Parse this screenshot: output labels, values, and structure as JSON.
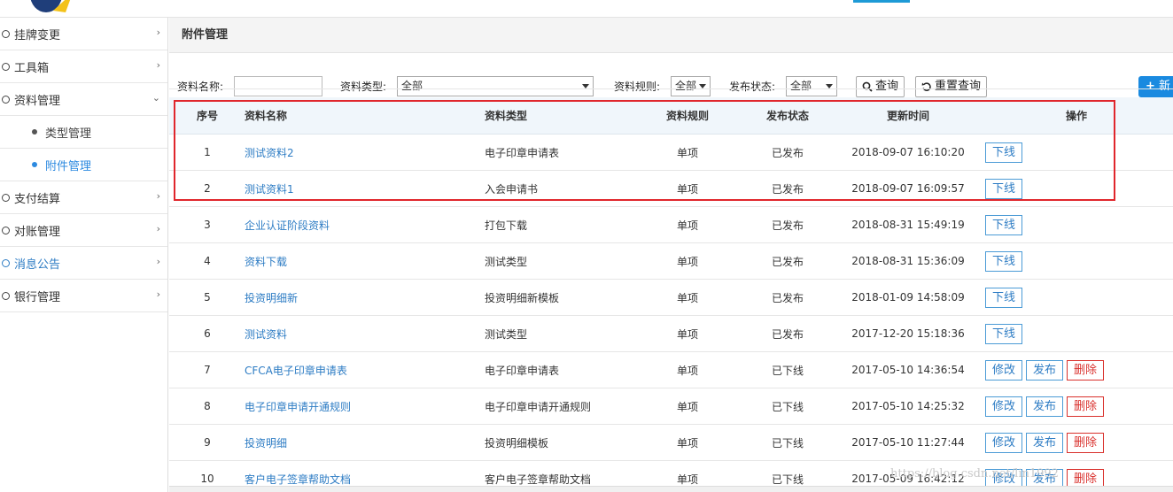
{
  "sidebar": {
    "items": [
      {
        "label": "挂牌变更"
      },
      {
        "label": "工具箱"
      },
      {
        "label": "资料管理"
      },
      {
        "label": "支付结算"
      },
      {
        "label": "对账管理"
      },
      {
        "label": "消息公告"
      },
      {
        "label": "银行管理"
      }
    ],
    "sub_items": [
      {
        "label": "类型管理"
      },
      {
        "label": "附件管理"
      }
    ]
  },
  "page": {
    "title": "附件管理"
  },
  "filters": {
    "name_label": "资料名称:",
    "name_value": "",
    "type_label": "资料类型:",
    "type_value": "全部",
    "rule_label": "资料规则:",
    "rule_value": "全部",
    "status_label": "发布状态:",
    "status_value": "全部",
    "query_label": "查询",
    "reset_label": "重置查询",
    "new_label": "新"
  },
  "table": {
    "headers": {
      "index": "序号",
      "name": "资料名称",
      "type": "资料类型",
      "rule": "资料规则",
      "status": "发布状态",
      "updated": "更新时间",
      "ops": "操作"
    },
    "rows": [
      {
        "index": "1",
        "name": "测试资料2",
        "type": "电子印章申请表",
        "rule": "单项",
        "status": "已发布",
        "updated": "2018-09-07 16:10:20",
        "ops": [
          "下线"
        ]
      },
      {
        "index": "2",
        "name": "测试资料1",
        "type": "入会申请书",
        "rule": "单项",
        "status": "已发布",
        "updated": "2018-09-07 16:09:57",
        "ops": [
          "下线"
        ]
      },
      {
        "index": "3",
        "name": "企业认证阶段资料",
        "type": "打包下载",
        "rule": "单项",
        "status": "已发布",
        "updated": "2018-08-31 15:49:19",
        "ops": [
          "下线"
        ]
      },
      {
        "index": "4",
        "name": "资料下载",
        "type": "测试类型",
        "rule": "单项",
        "status": "已发布",
        "updated": "2018-08-31 15:36:09",
        "ops": [
          "下线"
        ]
      },
      {
        "index": "5",
        "name": "投资明细新",
        "type": "投资明细新模板",
        "rule": "单项",
        "status": "已发布",
        "updated": "2018-01-09 14:58:09",
        "ops": [
          "下线"
        ]
      },
      {
        "index": "6",
        "name": "测试资料",
        "type": "测试类型",
        "rule": "单项",
        "status": "已发布",
        "updated": "2017-12-20 15:18:36",
        "ops": [
          "下线"
        ]
      },
      {
        "index": "7",
        "name": "CFCA电子印章申请表",
        "type": "电子印章申请表",
        "rule": "单项",
        "status": "已下线",
        "updated": "2017-05-10 14:36:54",
        "ops": [
          "修改",
          "发布",
          "删除"
        ]
      },
      {
        "index": "8",
        "name": "电子印章申请开通规则",
        "type": "电子印章申请开通规则",
        "rule": "单项",
        "status": "已下线",
        "updated": "2017-05-10 14:25:32",
        "ops": [
          "修改",
          "发布",
          "删除"
        ]
      },
      {
        "index": "9",
        "name": "投资明细",
        "type": "投资明细模板",
        "rule": "单项",
        "status": "已下线",
        "updated": "2017-05-10 11:27:44",
        "ops": [
          "修改",
          "发布",
          "删除"
        ]
      },
      {
        "index": "10",
        "name": "客户电子签章帮助文档",
        "type": "客户电子签章帮助文档",
        "rule": "单项",
        "status": "已下线",
        "updated": "2017-05-09 16:42:12",
        "ops": [
          "修改",
          "发布",
          "删除"
        ]
      }
    ]
  },
  "watermark": "https://blog.csdn.net/lin1992",
  "colors": {
    "accent": "#1a8ae0",
    "link": "#2d7cc4",
    "danger": "#d9302c",
    "highlight": "#e0262c"
  }
}
